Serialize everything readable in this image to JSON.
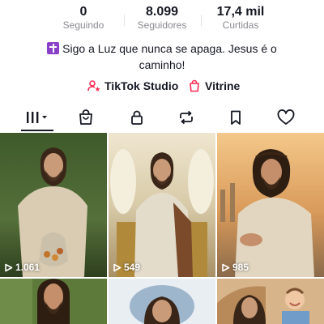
{
  "profile": {
    "stats": [
      {
        "value": "0",
        "label": "Seguindo"
      },
      {
        "value": "8.099",
        "label": "Seguidores"
      },
      {
        "value": "17,4 mil",
        "label": "Curtidas"
      }
    ],
    "bio": "Sigo a Luz que nunca se apaga. Jesus é o caminho!",
    "links": {
      "studio": "TikTok Studio",
      "vitrine": "Vitrine"
    }
  },
  "tabs": [
    "videos-grid",
    "shop",
    "private",
    "reposts",
    "favorites",
    "liked"
  ],
  "videos": [
    {
      "views": "1.061"
    },
    {
      "views": "549"
    },
    {
      "views": "985"
    },
    {
      "views": ""
    },
    {
      "views": ""
    },
    {
      "views": ""
    }
  ],
  "colors": {
    "text": "#161823",
    "secondary": "#8a8b91",
    "accent": "#fe2c55",
    "badge": "#8a3fc7"
  }
}
